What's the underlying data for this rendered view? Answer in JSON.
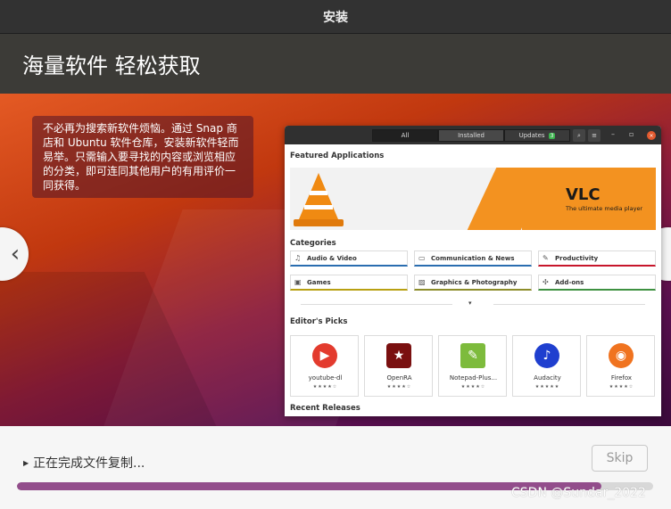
{
  "window": {
    "title": "安装"
  },
  "headline": "海量软件 轻松获取",
  "slide": {
    "caption": "不必再为搜索新软件烦恼。通过 Snap 商店和 Ubuntu 软件仓库，安装新软件轻而易举。只需输入要寻找的内容或浏览相应的分类，即可连同其他用户的有用评价一同获得。",
    "prev_icon": "‹",
    "next_icon": "›"
  },
  "store": {
    "tabs": [
      {
        "label": "All"
      },
      {
        "label": "Installed"
      },
      {
        "label": "Updates",
        "badge": "3"
      }
    ],
    "featured_title": "Featured Applications",
    "banner": {
      "title": "VLC",
      "subtitle": "The ultimate media player"
    },
    "categories_title": "Categories",
    "categories": [
      {
        "label": "Audio & Video",
        "icon": "music-icon"
      },
      {
        "label": "Communication & News",
        "icon": "chat-icon"
      },
      {
        "label": "Productivity",
        "icon": "edit-icon"
      },
      {
        "label": "Games",
        "icon": "game-icon"
      },
      {
        "label": "Graphics & Photography",
        "icon": "image-icon"
      },
      {
        "label": "Add-ons",
        "icon": "puzzle-icon"
      }
    ],
    "picks_title": "Editor's Picks",
    "picks": [
      {
        "name": "youtube-dl",
        "stars": "★★★★☆",
        "color": "#e33b2e"
      },
      {
        "name": "OpenRA",
        "stars": "★★★★☆",
        "color": "#7a1010"
      },
      {
        "name": "Notepad-Plus...",
        "stars": "★★★★☆",
        "color": "#7dbb3c"
      },
      {
        "name": "Audacity",
        "stars": "★★★★★",
        "color": "#1f3fcf"
      },
      {
        "name": "Firefox",
        "stars": "★★★★☆",
        "color": "#f0731f"
      }
    ],
    "recent_title": "Recent Releases"
  },
  "status": {
    "text": "正在完成文件复制..."
  },
  "skip_label": "Skip",
  "progress": {
    "fraction": 0.918
  },
  "watermark": "CSDN @Sundar_2022"
}
